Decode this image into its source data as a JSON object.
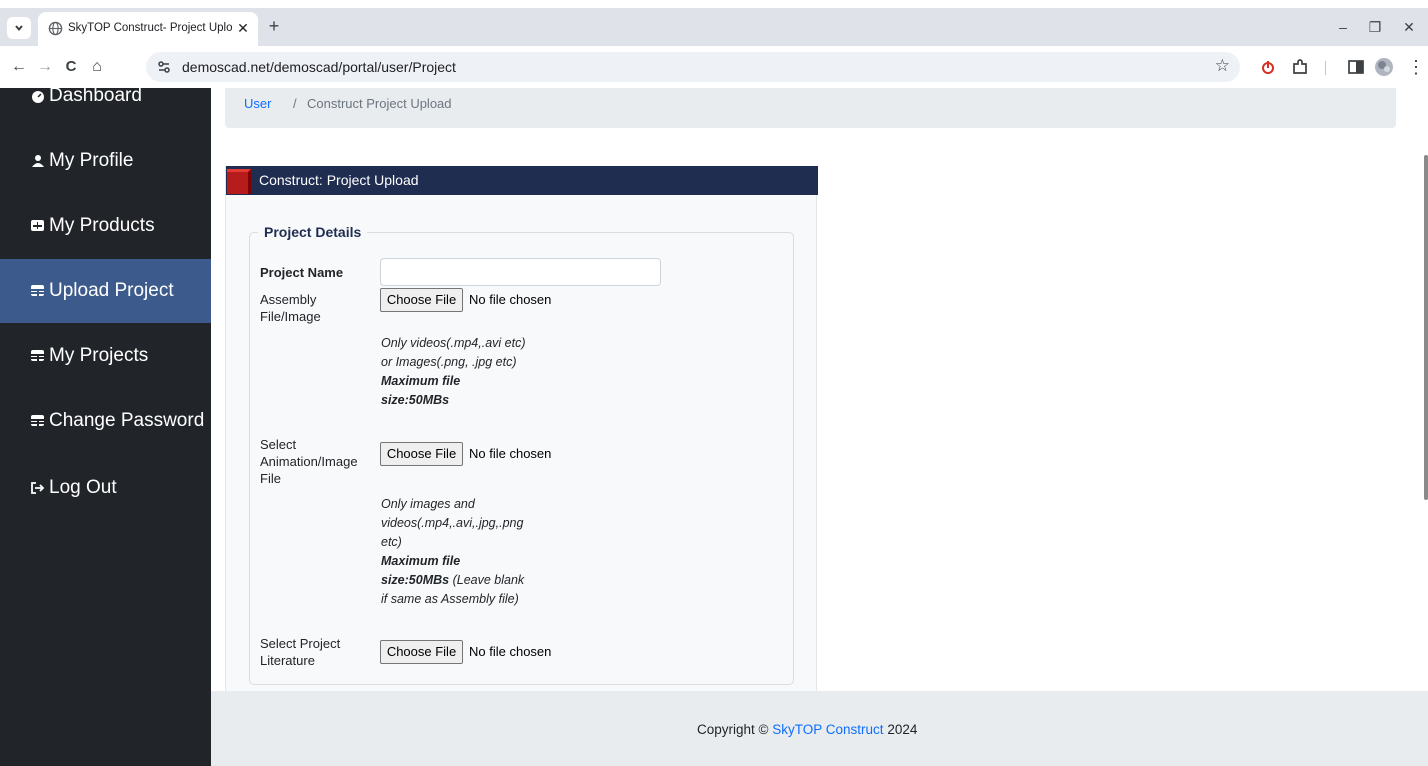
{
  "browser": {
    "tab_menu_icon": "chevron-down",
    "tab_title": "SkyTOP Construct- Project Uplo",
    "tab_close": "✕",
    "new_tab": "+",
    "minimize": "–",
    "restore": "❐",
    "close": "✕",
    "back": "←",
    "forward": "→",
    "reload": "C",
    "home": "⌂",
    "url": "demoscad.net/demoscad/portal/user/Project",
    "bookmark_star": "☆",
    "menu_dots": "⋮"
  },
  "sidebar": {
    "items": [
      {
        "label": "Dashboard",
        "icon": "dashboard-icon"
      },
      {
        "label": "My Profile",
        "icon": "user-icon"
      },
      {
        "label": "My Products",
        "icon": "plus-square-icon"
      },
      {
        "label": "Upload Project",
        "icon": "table-icon",
        "active": true
      },
      {
        "label": "My Projects",
        "icon": "table-icon"
      },
      {
        "label": "Change Password",
        "icon": "table-icon"
      },
      {
        "label": "Log Out",
        "icon": "sign-out-icon"
      }
    ]
  },
  "breadcrumb": {
    "user": "User",
    "separator": "/",
    "current": "Construct Project Upload"
  },
  "card": {
    "title": "Construct: Project Upload",
    "legend": "Project Details",
    "fields": {
      "project_name": {
        "label": "Project Name",
        "value": ""
      },
      "assembly": {
        "label": "Assembly File/Image",
        "button": "Choose File",
        "status": "No file chosen",
        "help": "Only videos(.mp4,.avi etc) or Images(.png, .jpg etc)",
        "help_max": "Maximum file size:50MBs"
      },
      "animation": {
        "label": "Select Animation/Image File",
        "button": "Choose File",
        "status": "No file chosen",
        "help": "Only images and videos(.mp4,.avi,.jpg,.png etc)",
        "help_max": "Maximum file size:50MBs",
        "help_note": "(Leave blank if same as Assembly file)"
      },
      "literature": {
        "label": "Select Project Literature",
        "button": "Choose File",
        "status": "No file chosen"
      }
    }
  },
  "footer": {
    "prefix": "Copyright ©",
    "brand": "SkyTOP Construct",
    "year": "2024"
  },
  "colors": {
    "sidebar_bg": "#212529",
    "sidebar_active": "#3d5a8c",
    "card_header": "#1f2d50",
    "link": "#0d6efd"
  }
}
